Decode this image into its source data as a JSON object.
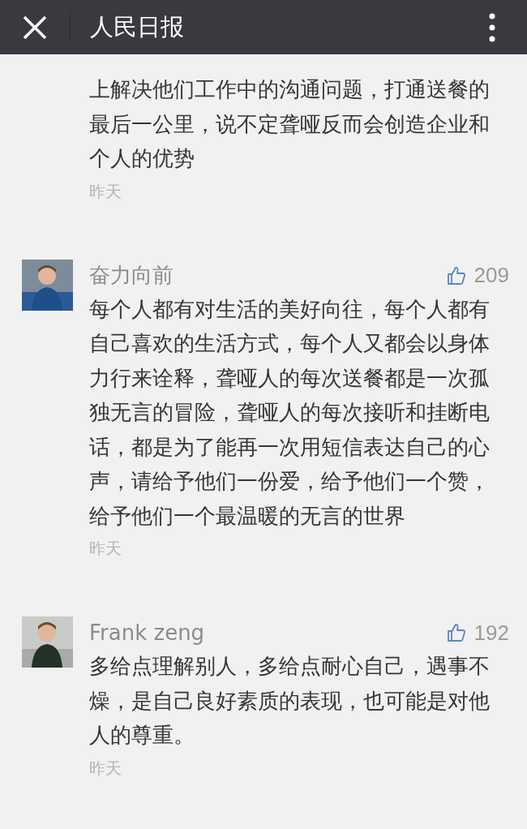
{
  "header": {
    "title": "人民日报"
  },
  "comments": [
    {
      "text": "上解决他们工作中的沟通问题，打通送餐的最后一公里，说不定聋哑反而会创造企业和个人的优势",
      "time": "昨天"
    },
    {
      "name": "奋力向前",
      "likes": "209",
      "text": "每个人都有对生活的美好向往，每个人都有自己喜欢的生活方式，每个人又都会以身体力行来诠释，聋哑人的每次送餐都是一次孤独无言的冒险，聋哑人的每次接听和挂断电话，都是为了能再一次用短信表达自己的心声，请给予他们一份爱，给予他们一个赞，给予他们一个最温暖的无言的世界",
      "time": "昨天"
    },
    {
      "name": "Frank zeng",
      "likes": "192",
      "text": "多给点理解别人，多给点耐心自己，遇事不燥，是自己良好素质的表现，也可能是对他人的尊重。",
      "time": "昨天"
    }
  ]
}
